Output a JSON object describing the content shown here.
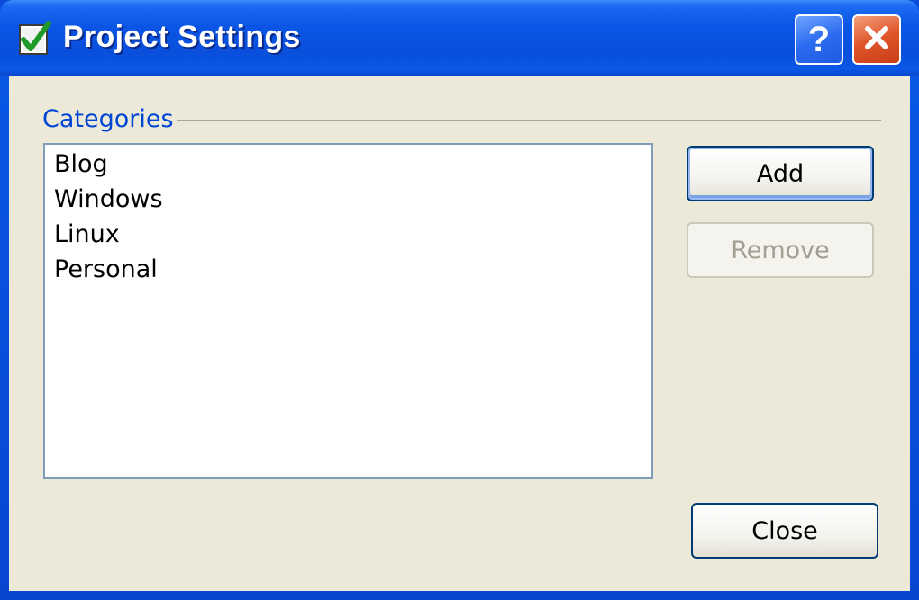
{
  "window": {
    "title": "Project Settings"
  },
  "titlebar": {
    "help_label": "?"
  },
  "categories": {
    "label": "Categories",
    "items": [
      "Blog",
      "Windows",
      "Linux",
      "Personal"
    ]
  },
  "buttons": {
    "add": "Add",
    "remove": "Remove",
    "close": "Close"
  },
  "colors": {
    "titlebar": "#0a4fdc",
    "client_background": "#ece9d8",
    "group_label": "#0046d5",
    "disabled_text": "#a19f92",
    "close_button": "#e0542a"
  }
}
